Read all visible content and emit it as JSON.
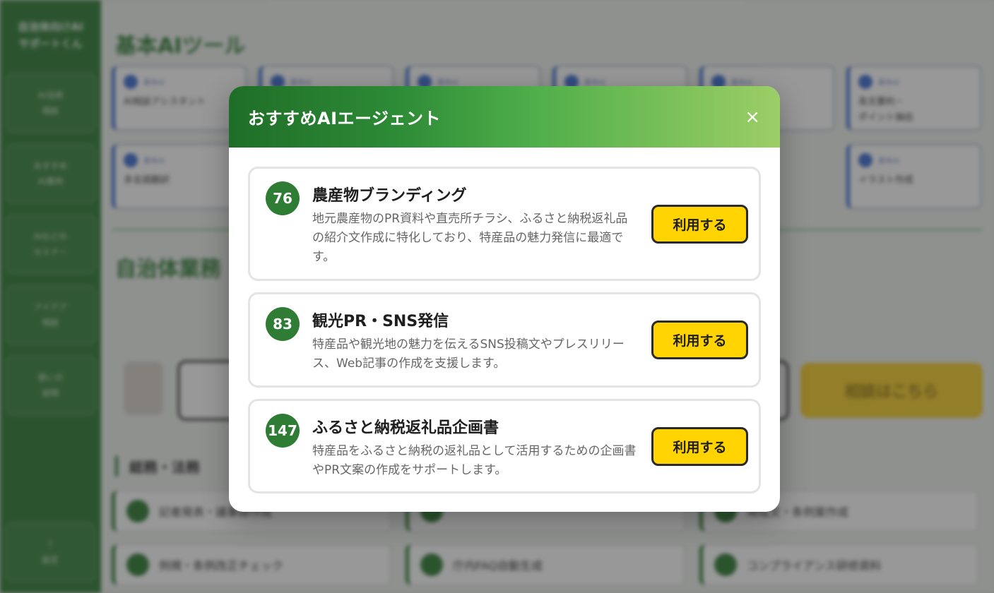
{
  "background": {
    "sidebar": {
      "brand": "自治体向けAI\nサポートくん",
      "items": [
        "AI活用\n相談",
        "おすすめ\nAI事例",
        "AIなどの\nセミナー",
        "アイデア\n相談",
        "使い方\n説明"
      ],
      "bottom_item": "?\n設定"
    },
    "section1_title": "基本AIツール",
    "tiles_row1": [
      {
        "tag": "基本AI",
        "label": "AI相談アシスタント"
      },
      {
        "tag": "基本AI",
        "label": ""
      },
      {
        "tag": "基本AI",
        "label": ""
      },
      {
        "tag": "基本AI",
        "label": ""
      },
      {
        "tag": "基本AI",
        "label": ""
      },
      {
        "tag": "基本AI",
        "label": "長文要約・\nポイント抽出"
      }
    ],
    "tiles_row2": [
      {
        "tag": "基本AI",
        "label": "多言語翻訳"
      },
      {
        "tag": "基本AI",
        "label": "イラスト作成"
      }
    ],
    "section2_title": "自治体業務",
    "section2_text": "",
    "cta_button": "相談はこちら",
    "category_label": "総務・法務",
    "cards": [
      "記者発表・議事録作成",
      "",
      "規程文・条例案作成",
      "例規・条例改正チェック",
      "庁内FAQ自動生成",
      "コンプライアンス研修資料"
    ]
  },
  "modal": {
    "title": "おすすめAIエージェント",
    "close_label": "×",
    "agents": [
      {
        "number": "76",
        "name": "農産物ブランディング",
        "description": "地元農産物のPR資料や直売所チラシ、ふるさと納税返礼品の紹介文作成に特化しており、特産品の魅力発信に最適です。",
        "button": "利用する"
      },
      {
        "number": "83",
        "name": "観光PR・SNS発信",
        "description": "特産品や観光地の魅力を伝えるSNS投稿文やプレスリリース、Web記事の作成を支援します。",
        "button": "利用する"
      },
      {
        "number": "147",
        "name": "ふるさと納税返礼品企画書",
        "description": "特産品をふるさと納税の返礼品として活用するための企画書やPR文案の作成をサポートします。",
        "button": "利用する"
      }
    ]
  },
  "colors": {
    "brand_green": "#2f7d35",
    "button_yellow": "#ffd400",
    "header_gradient_end": "#9cce66"
  }
}
